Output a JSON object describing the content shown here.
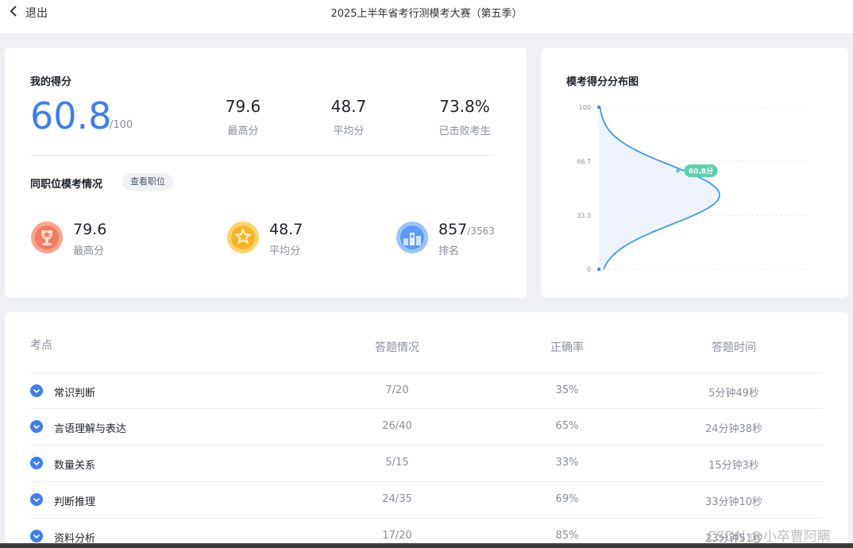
{
  "header": {
    "back_label": "退出",
    "title": "2025上半年省考行测模考大赛（第五季）"
  },
  "score": {
    "title": "我的得分",
    "value": "60.8",
    "max": "/100",
    "stats": [
      {
        "value": "79.6",
        "label": "最高分"
      },
      {
        "value": "48.7",
        "label": "平均分"
      },
      {
        "value": "73.8%",
        "label": "已击败考生"
      }
    ]
  },
  "peer": {
    "title": "同职位模考情况",
    "button": "查看职位",
    "items": [
      {
        "value": "79.6",
        "sub": "",
        "label": "最高分",
        "icon": "trophy-medal-icon",
        "color": "#f47b5c"
      },
      {
        "value": "48.7",
        "sub": "",
        "label": "平均分",
        "icon": "star-medal-icon",
        "color": "#f7b526"
      },
      {
        "value": "857",
        "sub": "/3563",
        "label": "排名",
        "icon": "ranking-icon",
        "color": "#5a9cf6"
      }
    ]
  },
  "distribution": {
    "title": "模考得分分布图",
    "marker_label": "60.8分",
    "accent": "#3d9bf0",
    "marker_color": "#5ccfae"
  },
  "chart_data": {
    "type": "area",
    "title": "模考得分分布图",
    "y_ticks": [
      "100",
      "66.7",
      "33.3",
      "0"
    ],
    "ylim": [
      0,
      100
    ],
    "marker": {
      "y": 60.8,
      "label": "60.8分"
    },
    "grid": true
  },
  "table": {
    "headers": [
      "考点",
      "答题情况",
      "正确率",
      "答题时间"
    ],
    "rows": [
      {
        "name": "常识判断",
        "answers": "7/20",
        "accuracy": "35%",
        "time": "5分钟49秒"
      },
      {
        "name": "言语理解与表达",
        "answers": "26/40",
        "accuracy": "65%",
        "time": "24分钟38秒"
      },
      {
        "name": "数量关系",
        "answers": "5/15",
        "accuracy": "33%",
        "time": "15分钟3秒"
      },
      {
        "name": "判断推理",
        "answers": "24/35",
        "accuracy": "69%",
        "time": "33分钟10秒"
      },
      {
        "name": "资料分析",
        "answers": "17/20",
        "accuracy": "85%",
        "time": "23分钟51秒"
      }
    ]
  },
  "watermark": "CSDN @小卒曹阿瞒"
}
